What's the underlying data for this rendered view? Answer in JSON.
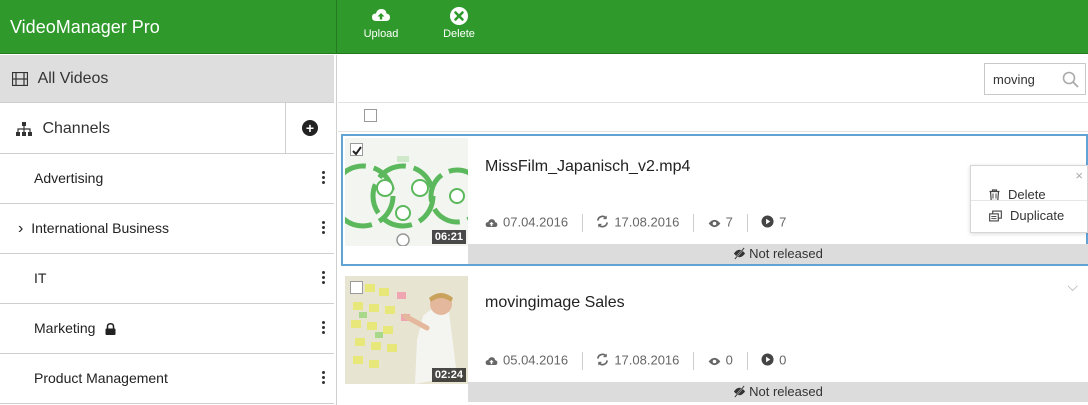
{
  "app": {
    "title": "VideoManager Pro"
  },
  "toolbar": {
    "upload_label": "Upload",
    "delete_label": "Delete"
  },
  "sidebar": {
    "all_videos_label": "All Videos",
    "channels_label": "Channels",
    "channels": [
      {
        "label": "Advertising",
        "expandable": false,
        "locked": false
      },
      {
        "label": "International Business",
        "expandable": true,
        "expand_glyph": "›",
        "locked": false
      },
      {
        "label": "IT",
        "expandable": false,
        "locked": false
      },
      {
        "label": "Marketing",
        "expandable": false,
        "locked": true
      },
      {
        "label": "Product Management",
        "expandable": false,
        "locked": false
      }
    ]
  },
  "search": {
    "value": "moving",
    "placeholder": ""
  },
  "videos": [
    {
      "title": "MissFilm_Japanisch_v2.mp4",
      "uploaded": "07.04.2016",
      "modified": "17.08.2016",
      "views": "7",
      "plays": "7",
      "duration": "06:21",
      "status": "Not released",
      "selected": true
    },
    {
      "title": "movingimage Sales",
      "uploaded": "05.04.2016",
      "modified": "17.08.2016",
      "views": "0",
      "plays": "0",
      "duration": "02:24",
      "status": "Not released",
      "selected": false
    }
  ],
  "context_menu": {
    "close_glyph": "×",
    "delete_label": "Delete",
    "duplicate_label": "Duplicate"
  },
  "colors": {
    "brand_green": "#2f9a2b",
    "selection_blue": "#62a3d6",
    "status_gray": "#dcdcdc"
  }
}
